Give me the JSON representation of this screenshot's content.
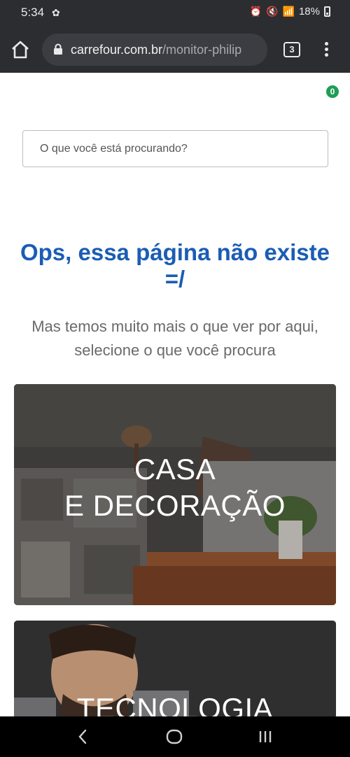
{
  "status_bar": {
    "time": "5:34",
    "battery": "18%"
  },
  "browser": {
    "url_domain": "carrefour.com.br",
    "url_path": "/monitor-philip",
    "tab_count": "3"
  },
  "page": {
    "cart_count": "0",
    "search_placeholder": "O que você está procurando?",
    "error_title": "Ops, essa página não existe =/",
    "error_subtitle": "Mas temos muito mais o que ver por aqui, selecione o que você procura",
    "categories": [
      {
        "line1": "CASA",
        "line2": "E DECORAÇÃO"
      },
      {
        "line1": "TECNOLOGIA"
      }
    ]
  }
}
